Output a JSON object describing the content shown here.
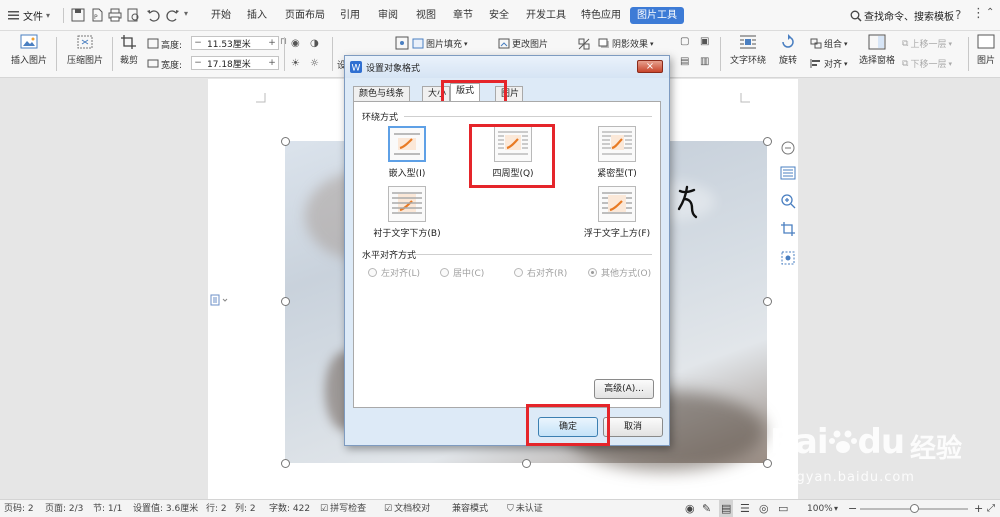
{
  "menubar": {
    "file_label": "文件",
    "tabs": [
      "开始",
      "插入",
      "页面布局",
      "引用",
      "审阅",
      "视图",
      "章节",
      "安全",
      "开发工具",
      "特色应用",
      "图片工具"
    ],
    "active_tab": "图片工具",
    "search_label": "查找命令、搜索模板"
  },
  "ribbon": {
    "insert_picture": "插入图片",
    "compress_picture": "压缩图片",
    "crop": "裁剪",
    "height_label": "高度:",
    "height_value": "11.53厘米",
    "width_label": "宽度:",
    "width_value": "17.18厘米",
    "picture_fill": "图片填充",
    "change_picture": "更改图片",
    "shadow_effect": "阴影效果",
    "text_wrap": "文字环绕",
    "rotate": "旋转",
    "group": "组合",
    "align": "对齐",
    "selection_pane": "选择窗格",
    "bring_forward": "上移一层",
    "send_backward": "下移一层",
    "picture_more": "图片",
    "minus": "−",
    "plus": "+"
  },
  "dialog": {
    "title": "设置对象格式",
    "close": "×",
    "tabs": [
      "颜色与线条",
      "大小",
      "版式",
      "图片"
    ],
    "active_tab": "版式",
    "wrap_section": "环绕方式",
    "wrap_options": [
      {
        "label": "嵌入型(I)"
      },
      {
        "label": "四周型(Q)"
      },
      {
        "label": "紧密型(T)"
      },
      {
        "label": "衬于文字下方(B)"
      },
      {
        "label": "浮于文字上方(F)"
      }
    ],
    "halign_section": "水平对齐方式",
    "halign_options": [
      "左对齐(L)",
      "居中(C)",
      "右对齐(R)",
      "其他方式(O)"
    ],
    "halign_selected": "其他方式(O)",
    "advanced": "高级(A)...",
    "ok": "确定",
    "cancel": "取消"
  },
  "statusbar": {
    "page_num": "页码: 2",
    "pages": "页面: 2/3",
    "section": "节: 1/1",
    "setting": "设置值: 3.6厘米",
    "row": "行: 2",
    "col": "列: 2",
    "words": "字数: 422",
    "spell_check": "拼写检查",
    "doc_proof": "文档校对",
    "compat_mode": "兼容模式",
    "uncertified": "未认证",
    "zoom": "100%"
  },
  "watermark": {
    "brand": "Bai",
    "brand2": "du",
    "cn": "经验",
    "url": "jingyan.baidu.com"
  },
  "colors": {
    "accent": "#3d7bd6",
    "highlight": "#e5252a",
    "dialog_bg": "#ddeaf7"
  }
}
